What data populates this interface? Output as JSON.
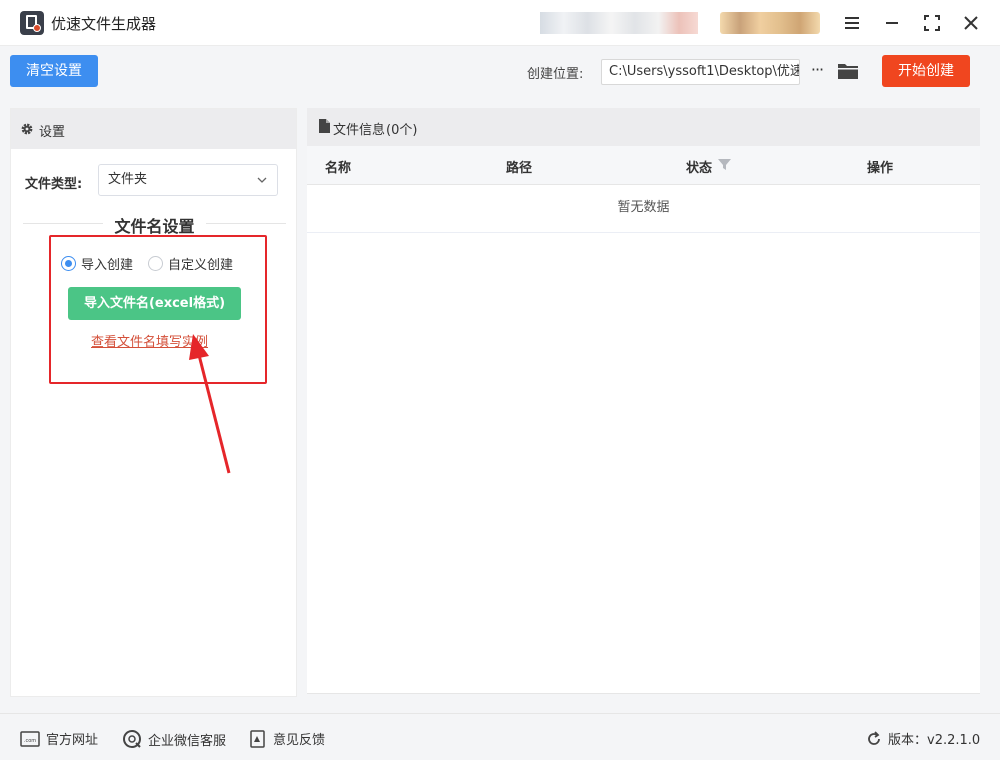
{
  "app": {
    "title": "优速文件生成器"
  },
  "toolbar": {
    "clear_label": "清空设置",
    "location_label": "创建位置:",
    "location_value": "C:\\Users\\yssoft1\\Desktop\\优速",
    "more_label": "···",
    "start_label": "开始创建"
  },
  "settings": {
    "header": "设置",
    "type_label": "文件类型:",
    "type_value": "文件夹",
    "section_title": "文件名设置",
    "radio_import": "导入创建",
    "radio_custom": "自定义创建",
    "import_button": "导入文件名(excel格式)",
    "example_link": "查看文件名填写实例"
  },
  "fileinfo": {
    "header": "文件信息",
    "count": "(0个)",
    "columns": [
      "名称",
      "路径",
      "状态",
      "操作"
    ],
    "empty_text": "暂无数据"
  },
  "footer": {
    "website": "官方网址",
    "wechat": "企业微信客服",
    "feedback": "意见反馈",
    "version": "版本：v2.2.1.0"
  },
  "colors": {
    "primary": "#3d8ef0",
    "danger": "#f0461f",
    "success": "#4bc586",
    "annotation": "#e5262a"
  }
}
